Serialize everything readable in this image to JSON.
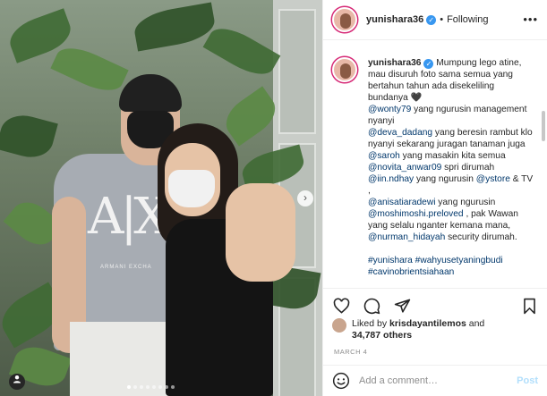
{
  "post": {
    "username": "yunishara36",
    "follow_status": "Following",
    "separator": "•",
    "verified_icon": "verified-badge-icon",
    "more_label": "•••"
  },
  "photo": {
    "shirt_logo": "A|X",
    "shirt_sub": "ARMANI EXCHA",
    "dot_count": 8,
    "active_dot": 0,
    "next_label": "›",
    "tag_icon": "user-tag-icon"
  },
  "caption": {
    "username": "yunishara36",
    "line1": " Mumpung lego atine, mau disuruh foto sama semua yang bertahun tahun ada disekeliling bundanya 🖤",
    "m1": "@wonty79",
    "t1": " yang ngurusin management nyanyi",
    "m2": "@deva_dadang",
    "t2": " yang beresin rambut klo nyanyi sekarang juragan tanaman juga",
    "m3": "@saroh",
    "t3": " yang masakin kita semua",
    "m4": "@novita_anwar09",
    "t4": " spri dirumah",
    "m5": "@iin.ndhay",
    "t5": " yang ngurusin ",
    "m6": "@ystore",
    "t6": " & TV , ",
    "m7": "@anisatiaradewi",
    "t7": " yang ngurusin ",
    "m8": "@moshimoshi.preloved",
    "t8": " , pak Wawan yang selalu nganter kemana mana, ",
    "m9": "@nurman_hidayah",
    "t9": " security dirumah.",
    "hashtags": "#yunishara #wahyusetyaningbudi #cavinobrientsiahaan"
  },
  "actions": {
    "like_icon": "heart-icon",
    "comment_icon": "comment-icon",
    "share_icon": "share-icon",
    "save_icon": "bookmark-icon"
  },
  "likes": {
    "prefix": "Liked by ",
    "user": "krisdayantilemos",
    "mid": " and",
    "count": "34,787 others"
  },
  "date": "MARCH 4",
  "comment_box": {
    "placeholder": "Add a comment…",
    "post_label": "Post",
    "emoji_icon": "emoji-icon"
  },
  "colors": {
    "link": "#00376b",
    "verified": "#3897f0",
    "post_disabled": "#b2dffc"
  }
}
